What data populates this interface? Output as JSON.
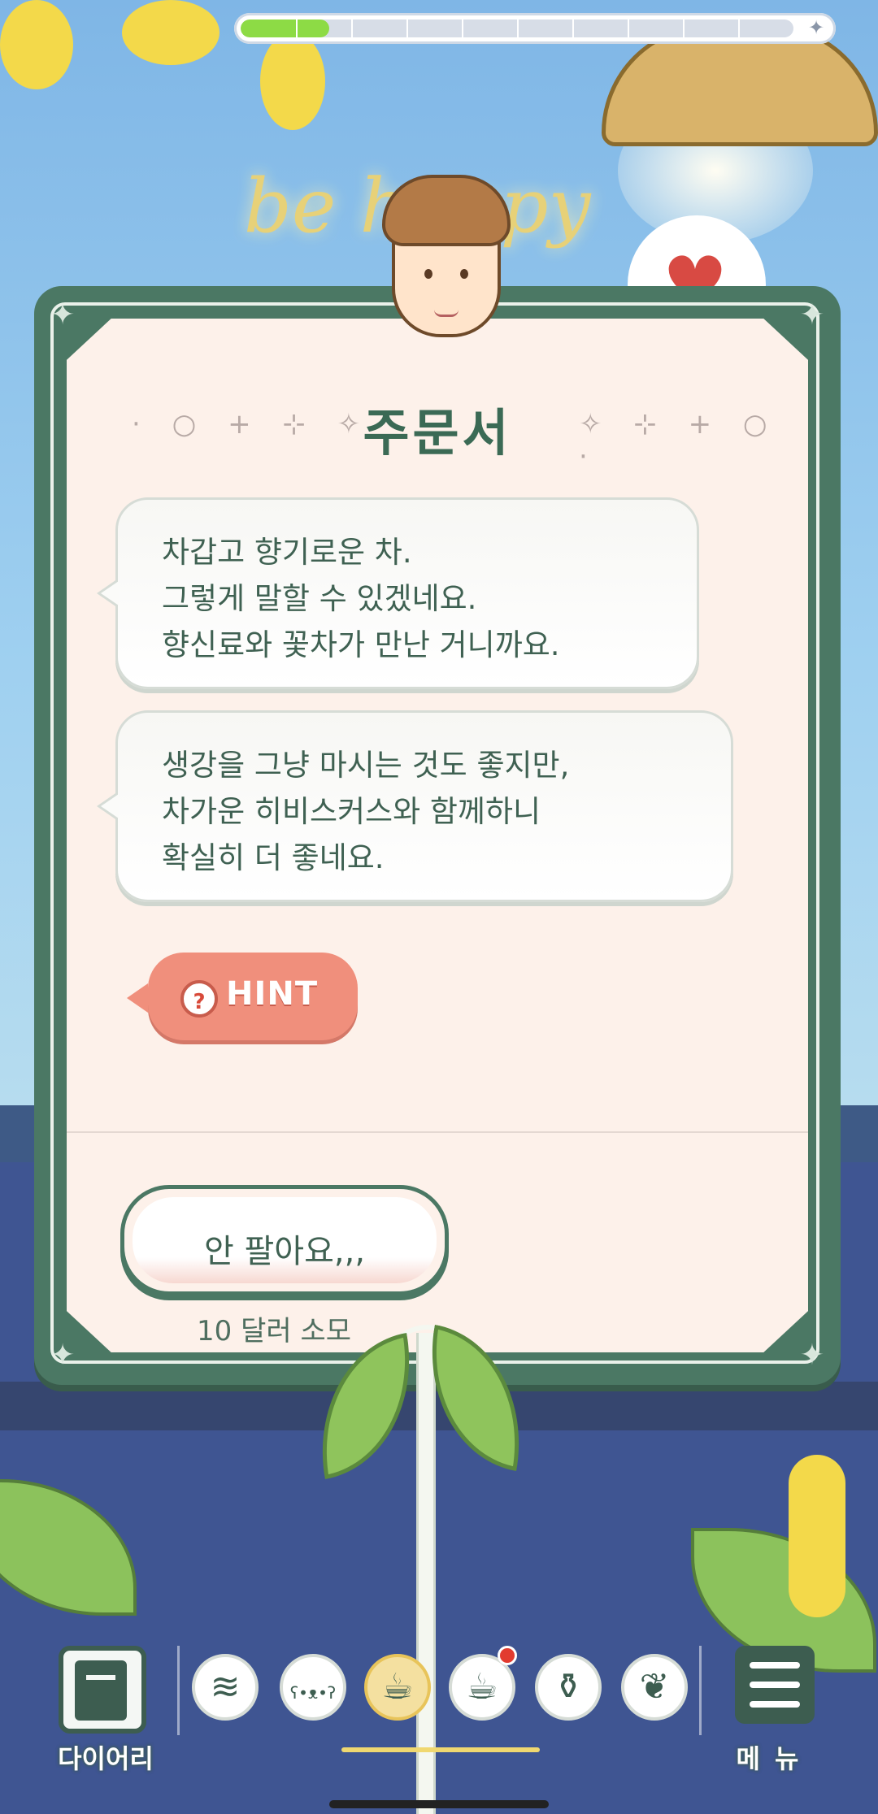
{
  "progress": {
    "value_fraction": 0.16,
    "segments": 10
  },
  "background": {
    "sign_text": "be happy"
  },
  "card": {
    "title": "주문서",
    "title_decoration_left": "· ○ + ⊹ ✧",
    "title_decoration_right": "✧ ⊹ + ○ ·",
    "messages": [
      {
        "lines": [
          "차갑고 향기로운 차.",
          "그렇게 말할 수 있겠네요.",
          "향신료와 꽃차가 만난 거니까요."
        ]
      },
      {
        "lines": [
          "생강을 그냥 마시는 것도 좋지만,",
          "차가운 히비스커스와 함께하니",
          "확실히 더 좋네요."
        ]
      }
    ],
    "hint_label": "HINT",
    "decline_button": "안 팔아요,,,",
    "decline_cost": "10 달러 소모"
  },
  "bottom_bar": {
    "diary_label": "다이어리",
    "menu_label": "메뉴",
    "tools": [
      {
        "icon": "sweep-icon",
        "glyph": "≋"
      },
      {
        "icon": "bear-icon",
        "glyph": "ʕ•ᴥ•ʔ"
      },
      {
        "icon": "cup-icon",
        "glyph": "☕",
        "active": true
      },
      {
        "icon": "mug-icon",
        "glyph": "☕",
        "notification": true
      },
      {
        "icon": "watering-can-icon",
        "glyph": "⚱"
      },
      {
        "icon": "potted-plant-icon",
        "glyph": "❦"
      }
    ]
  },
  "colors": {
    "card_frame": "#4b7864",
    "card_paper": "#fdf1ea",
    "hint": "#f08f7c",
    "progress_fill": "#8ddb45",
    "notification": "#e23b2f"
  }
}
